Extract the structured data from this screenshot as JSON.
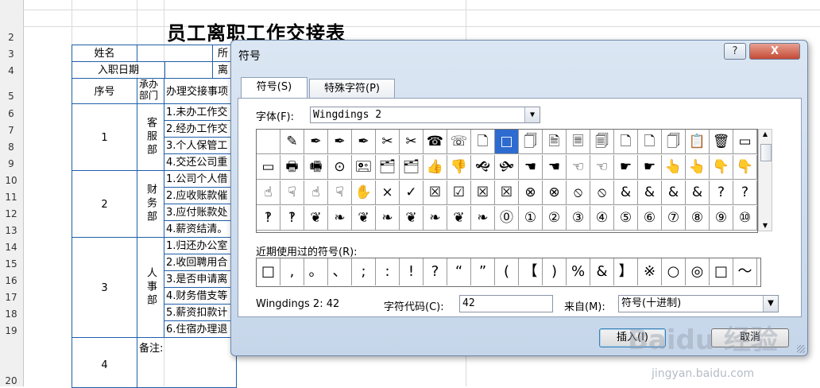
{
  "sheet": {
    "row_numbers": [
      "2",
      "3",
      "4",
      "5",
      "6",
      "7",
      "8",
      "9",
      "10",
      "11",
      "12",
      "13",
      "14",
      "15",
      "16",
      "17",
      "18",
      "19",
      "20"
    ],
    "title": "员工离职工作交接表",
    "labels": {
      "name": "姓名",
      "dept_partial": "所",
      "join_date": "入职日期",
      "leave_partial": "离",
      "seq": "序号",
      "dept_col": "承办部门",
      "tasks_col": "办理交接事项",
      "remark": "备注:"
    },
    "seq_numbers": [
      "1",
      "2",
      "3",
      "4"
    ],
    "departments": [
      "客服部",
      "财务部",
      "人事部"
    ],
    "tasks": [
      "1.未办工作交",
      "2.经办工作交",
      "3.个人保管工",
      "4.交还公司重",
      "1.公司个人借",
      "2.应收账款催",
      "3.应付账款处",
      "4.薪资结清。",
      "1.归还办公室",
      "2.收回聘用合",
      "3.是否申请离",
      "4.财务借支等",
      "5.薪资扣款计",
      "6.住宿办理退"
    ]
  },
  "dialog": {
    "title": "符号",
    "help_button": "?",
    "close_button": "X",
    "tabs": [
      "符号(S)",
      "特殊字符(P)"
    ],
    "font_label": "字体(F):",
    "font_value": "Wingdings 2",
    "symbols": [
      "",
      "✎",
      "✒",
      "✒",
      "✒",
      "✂",
      "✂",
      "☎",
      "☏",
      "🗋",
      "□",
      "🗍",
      "🗎",
      "🗏",
      "🗐",
      "🗋",
      "🗋",
      "🗍",
      "📋",
      "🗑",
      "▭",
      "▭",
      "🖶",
      "🖷",
      "⊙",
      "🖭",
      "🗂",
      "🗂",
      "👍",
      "👎",
      "🙝",
      "🙟",
      "☚",
      "☚",
      "☜",
      "☜",
      "☛",
      "☛",
      "👆",
      "👆",
      "👇",
      "👇",
      "☝",
      "☟",
      "☝",
      "☟",
      "✋",
      "×",
      "✓",
      "☒",
      "☑",
      "☒",
      "☒",
      "⊗",
      "⊗",
      "⦸",
      "⦸",
      "&",
      "&",
      "&",
      "&",
      "?",
      "?",
      "‽",
      "‽",
      "❦",
      "❧",
      "❦",
      "❧",
      "❦",
      "❧",
      "❦",
      "❧",
      "⓪",
      "①",
      "②",
      "③",
      "④",
      "⑤",
      "⑥",
      "⑦",
      "⑧",
      "⑨",
      "⑩"
    ],
    "recent_label": "近期使用过的符号(R):",
    "recent_symbols": [
      "□",
      ",",
      "。",
      "、",
      ";",
      ":",
      "!",
      "?",
      "“",
      "”",
      "(",
      "【",
      ")",
      "%",
      "&",
      "】",
      "※",
      "○",
      "◎",
      "□",
      "〜"
    ],
    "char_name": "Wingdings 2: 42",
    "code_label": "字符代码(C):",
    "code_value": "42",
    "from_label": "来自(M):",
    "from_value": "符号(十进制)",
    "insert_button": "插入(I)",
    "cancel_button": "取消"
  },
  "watermark": {
    "logo": "Baidu 经验",
    "url": "jingyan.baidu.com"
  }
}
